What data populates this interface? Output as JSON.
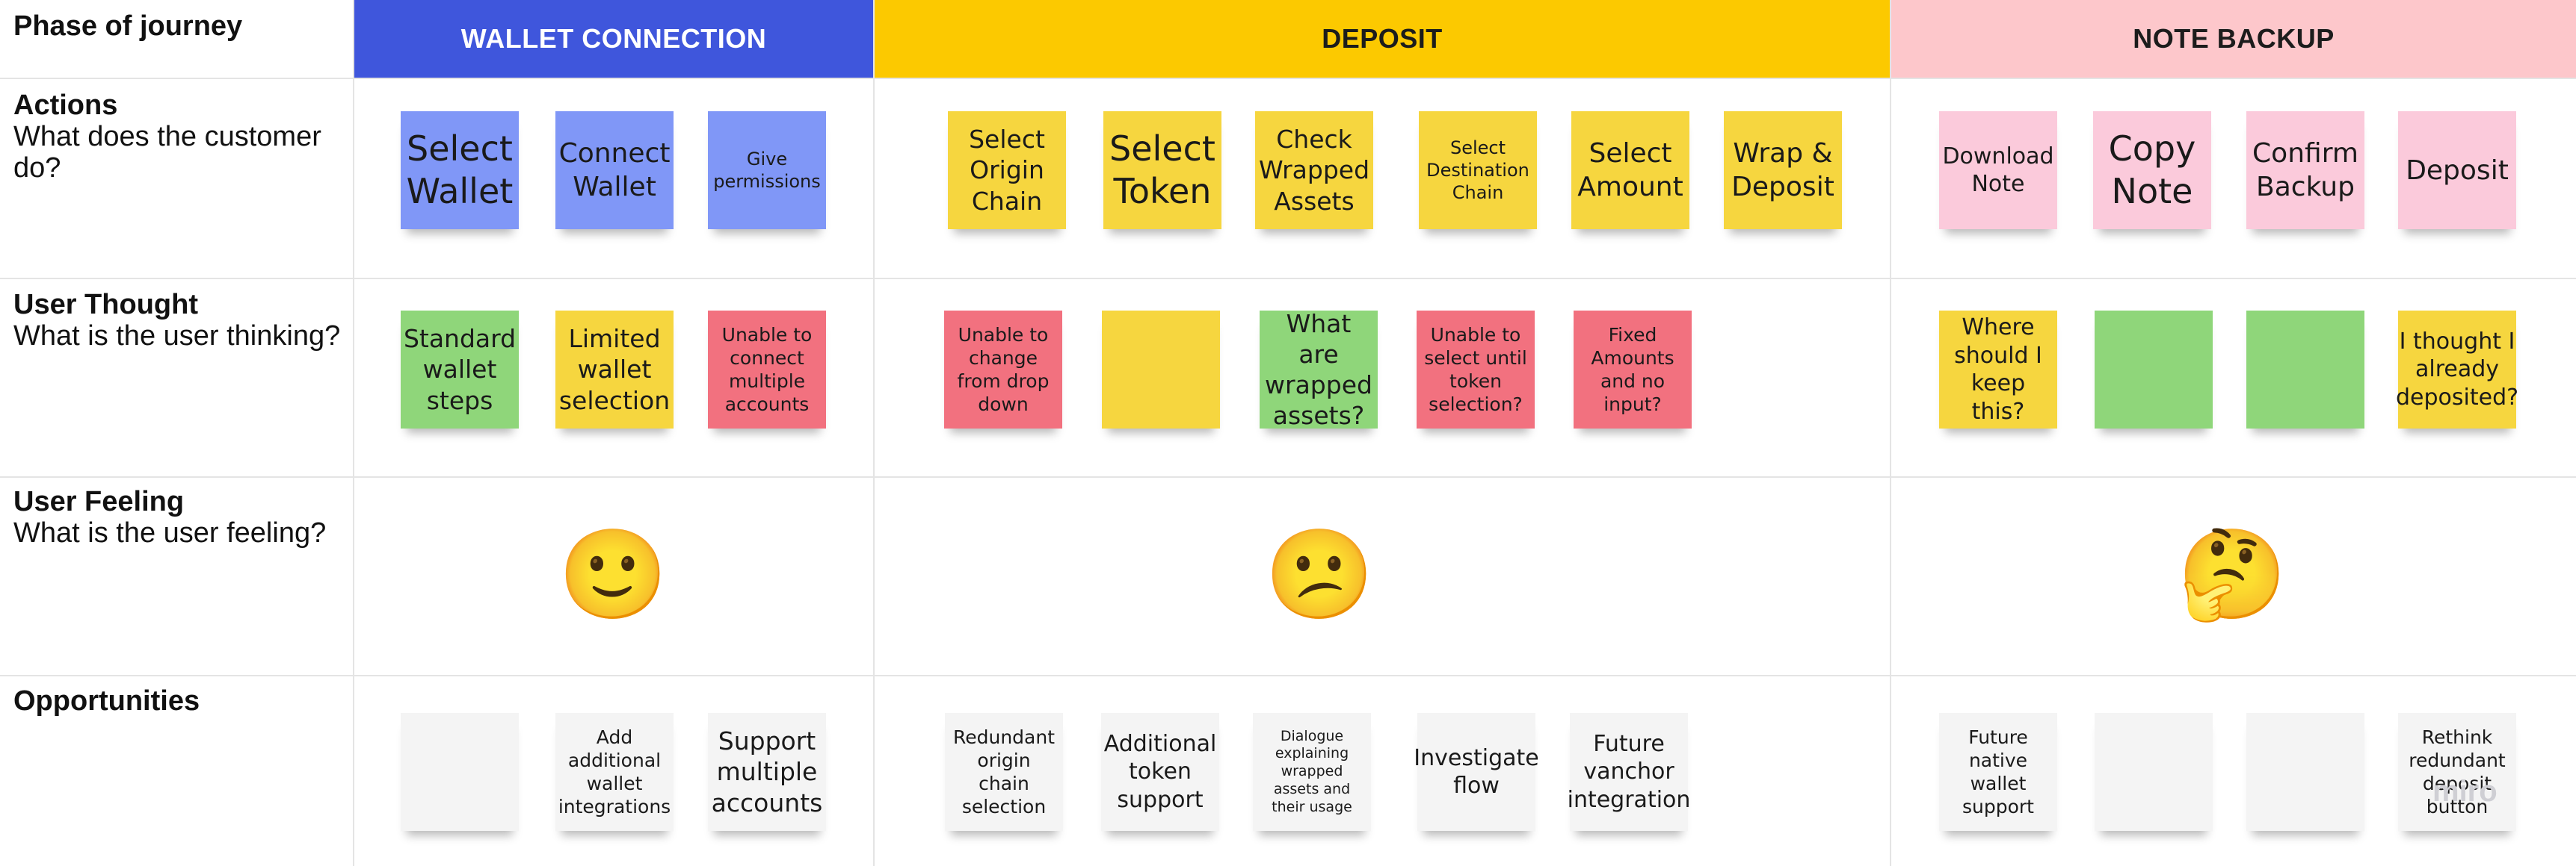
{
  "board": {
    "phase_header_label": "Phase of journey",
    "watermark": "miro"
  },
  "phases": [
    {
      "id": "wallet",
      "label": "WALLET CONNECTION",
      "bg": "#3f56dc",
      "fg": "#ffffff"
    },
    {
      "id": "deposit",
      "label": "DEPOSIT",
      "bg": "#fcc900",
      "fg": "#1c1c1c"
    },
    {
      "id": "backup",
      "label": "NOTE BACKUP",
      "bg": "#fdc7cb",
      "fg": "#1c1c1c"
    }
  ],
  "rows": [
    {
      "id": "actions",
      "title": "Actions",
      "subtitle": "What does the customer do?"
    },
    {
      "id": "thought",
      "title": "User Thought",
      "subtitle": "What is the user thinking?"
    },
    {
      "id": "feeling",
      "title": "User Feeling",
      "subtitle": "What is the user feeling?"
    },
    {
      "id": "opportunities",
      "title": "Opportunities",
      "subtitle": ""
    }
  ],
  "colors": {
    "blue": "#8097f7",
    "yellow": "#f6d63f",
    "pink": "#fbcadb",
    "green": "#8fd67a",
    "red": "#f2717f",
    "white": "#f4f4f4"
  },
  "stickies": {
    "actions": [
      {
        "text": "Select Wallet",
        "color": "blue",
        "size": "xl"
      },
      {
        "text": "Connect Wallet",
        "color": "blue",
        "size": "l"
      },
      {
        "text": "Give permissions",
        "color": "blue",
        "size": "s"
      },
      {
        "text": "Select Origin Chain",
        "color": "yellow",
        "size": "m"
      },
      {
        "text": "Select Token",
        "color": "yellow",
        "size": "xl"
      },
      {
        "text": "Check Wrapped Assets",
        "color": "yellow",
        "size": "m"
      },
      {
        "text": "Select Destination Chain",
        "color": "yellow",
        "size": "s"
      },
      {
        "text": "Select Amount",
        "color": "yellow",
        "size": "l"
      },
      {
        "text": "Wrap & Deposit",
        "color": "yellow",
        "size": "l"
      },
      {
        "text": "Download Note",
        "color": "pink",
        "size": "m2"
      },
      {
        "text": "Copy Note",
        "color": "pink",
        "size": "xl"
      },
      {
        "text": "Confirm Backup",
        "color": "pink",
        "size": "l"
      },
      {
        "text": "Deposit",
        "color": "pink",
        "size": "l"
      }
    ],
    "thought": [
      {
        "text": "Standard wallet steps",
        "color": "green",
        "size": "m"
      },
      {
        "text": "Limited wallet selection",
        "color": "yellow",
        "size": "m"
      },
      {
        "text": "Unable to connect multiple accounts",
        "color": "red",
        "size": "s2"
      },
      {
        "text": "Unable to change from drop down",
        "color": "red",
        "size": "s2"
      },
      {
        "text": "",
        "color": "yellow",
        "size": "s"
      },
      {
        "text": "What are wrapped assets?",
        "color": "green",
        "size": "m"
      },
      {
        "text": "Unable to select until token selection?",
        "color": "red",
        "size": "s2"
      },
      {
        "text": "Fixed Amounts and no input?",
        "color": "red",
        "size": "s2"
      },
      {
        "text": "Where should I keep this?",
        "color": "yellow",
        "size": "m2"
      },
      {
        "text": "",
        "color": "green",
        "size": "s"
      },
      {
        "text": "",
        "color": "green",
        "size": "s"
      },
      {
        "text": "I thought I already deposited?",
        "color": "yellow",
        "size": "m2"
      }
    ],
    "opportunities": [
      {
        "text": "",
        "color": "white",
        "size": "s"
      },
      {
        "text": "Add additional wallet integrations",
        "color": "white",
        "size": "s2"
      },
      {
        "text": "Support multiple accounts",
        "color": "white",
        "size": "m"
      },
      {
        "text": "Redundant origin chain selection",
        "color": "white",
        "size": "s2"
      },
      {
        "text": "Additional token support",
        "color": "white",
        "size": "m2"
      },
      {
        "text": "Dialogue explaining wrapped assets and their usage",
        "color": "white",
        "size": "xs"
      },
      {
        "text": "Investigate flow",
        "color": "white",
        "size": "m2"
      },
      {
        "text": "Future vanchor integration",
        "color": "white",
        "size": "m2"
      },
      {
        "text": "Future native wallet support",
        "color": "white",
        "size": "s2"
      },
      {
        "text": "",
        "color": "white",
        "size": "s"
      },
      {
        "text": "",
        "color": "white",
        "size": "s"
      },
      {
        "text": "Rethink redundant deposit button",
        "color": "white",
        "size": "s2"
      }
    ]
  },
  "feelings": [
    {
      "phase": "wallet",
      "emoji": "🙂",
      "icon": "slightly-smiling-face-icon"
    },
    {
      "phase": "deposit",
      "emoji": "😕",
      "icon": "confused-face-icon"
    },
    {
      "phase": "backup",
      "emoji": "🤔",
      "icon": "thinking-face-icon"
    }
  ]
}
